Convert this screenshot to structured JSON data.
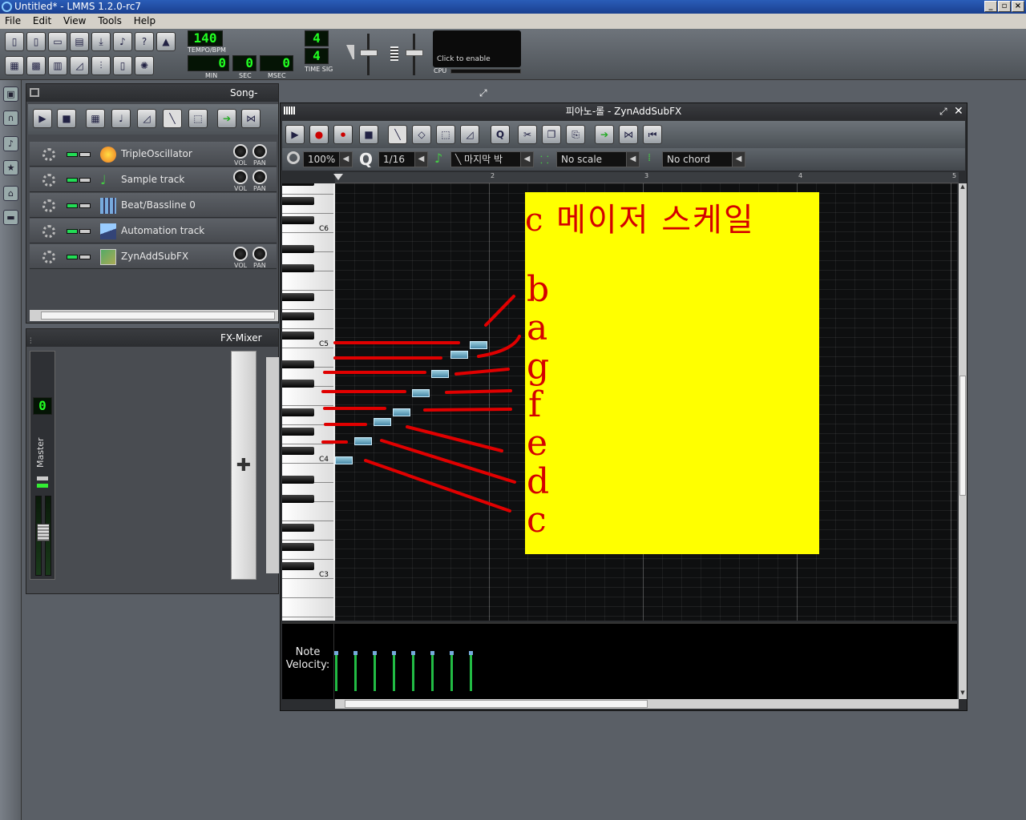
{
  "window": {
    "title": "Untitled* - LMMS 1.2.0-rc7"
  },
  "menu": [
    "File",
    "Edit",
    "View",
    "Tools",
    "Help"
  ],
  "toolbar": {
    "tempo": "140",
    "tempo_label": "TEMPO/BPM",
    "min": "0",
    "sec": "0",
    "msec": "0",
    "min_label": "MIN",
    "sec_label": "SEC",
    "msec_label": "MSEC",
    "timesig_top": "4",
    "timesig_bottom": "4",
    "timesig_label": "TIME SIG",
    "cpu_hint": "Click to enable",
    "cpu_label": "CPU"
  },
  "song_editor": {
    "title": "Song-Editor",
    "tracks": [
      {
        "name": "TripleOscillator",
        "has_knobs": true
      },
      {
        "name": "Sample track",
        "has_knobs": true
      },
      {
        "name": "Beat/Bassline 0",
        "has_knobs": false
      },
      {
        "name": "Automation track",
        "has_knobs": false
      },
      {
        "name": "ZynAddSubFX",
        "has_knobs": true
      }
    ],
    "vol_label": "VOL",
    "pan_label": "PAN"
  },
  "fx_mixer": {
    "title": "FX-Mixer",
    "channel_label": "Master",
    "channel_number": "0"
  },
  "piano_roll": {
    "title": "피아노-롤 - ZynAddSubFX",
    "zoom": "100%",
    "quantize": "1/16",
    "note_length": "마지막 박",
    "scale": "No scale",
    "chord": "No chord",
    "ruler": [
      "2",
      "3",
      "4",
      "5"
    ],
    "octaves": [
      "C6",
      "C5",
      "C4",
      "C3"
    ],
    "velocity_label": "Note\nVelocity:"
  },
  "annotation": {
    "title": "c 메이저 스케일",
    "letters": [
      "b",
      "a",
      "g",
      "f",
      "e",
      "d",
      "c"
    ]
  },
  "colors": {
    "annotation_bg": "#ffff00",
    "annotation_ink": "#d40000",
    "note": "#4a8aa8"
  }
}
